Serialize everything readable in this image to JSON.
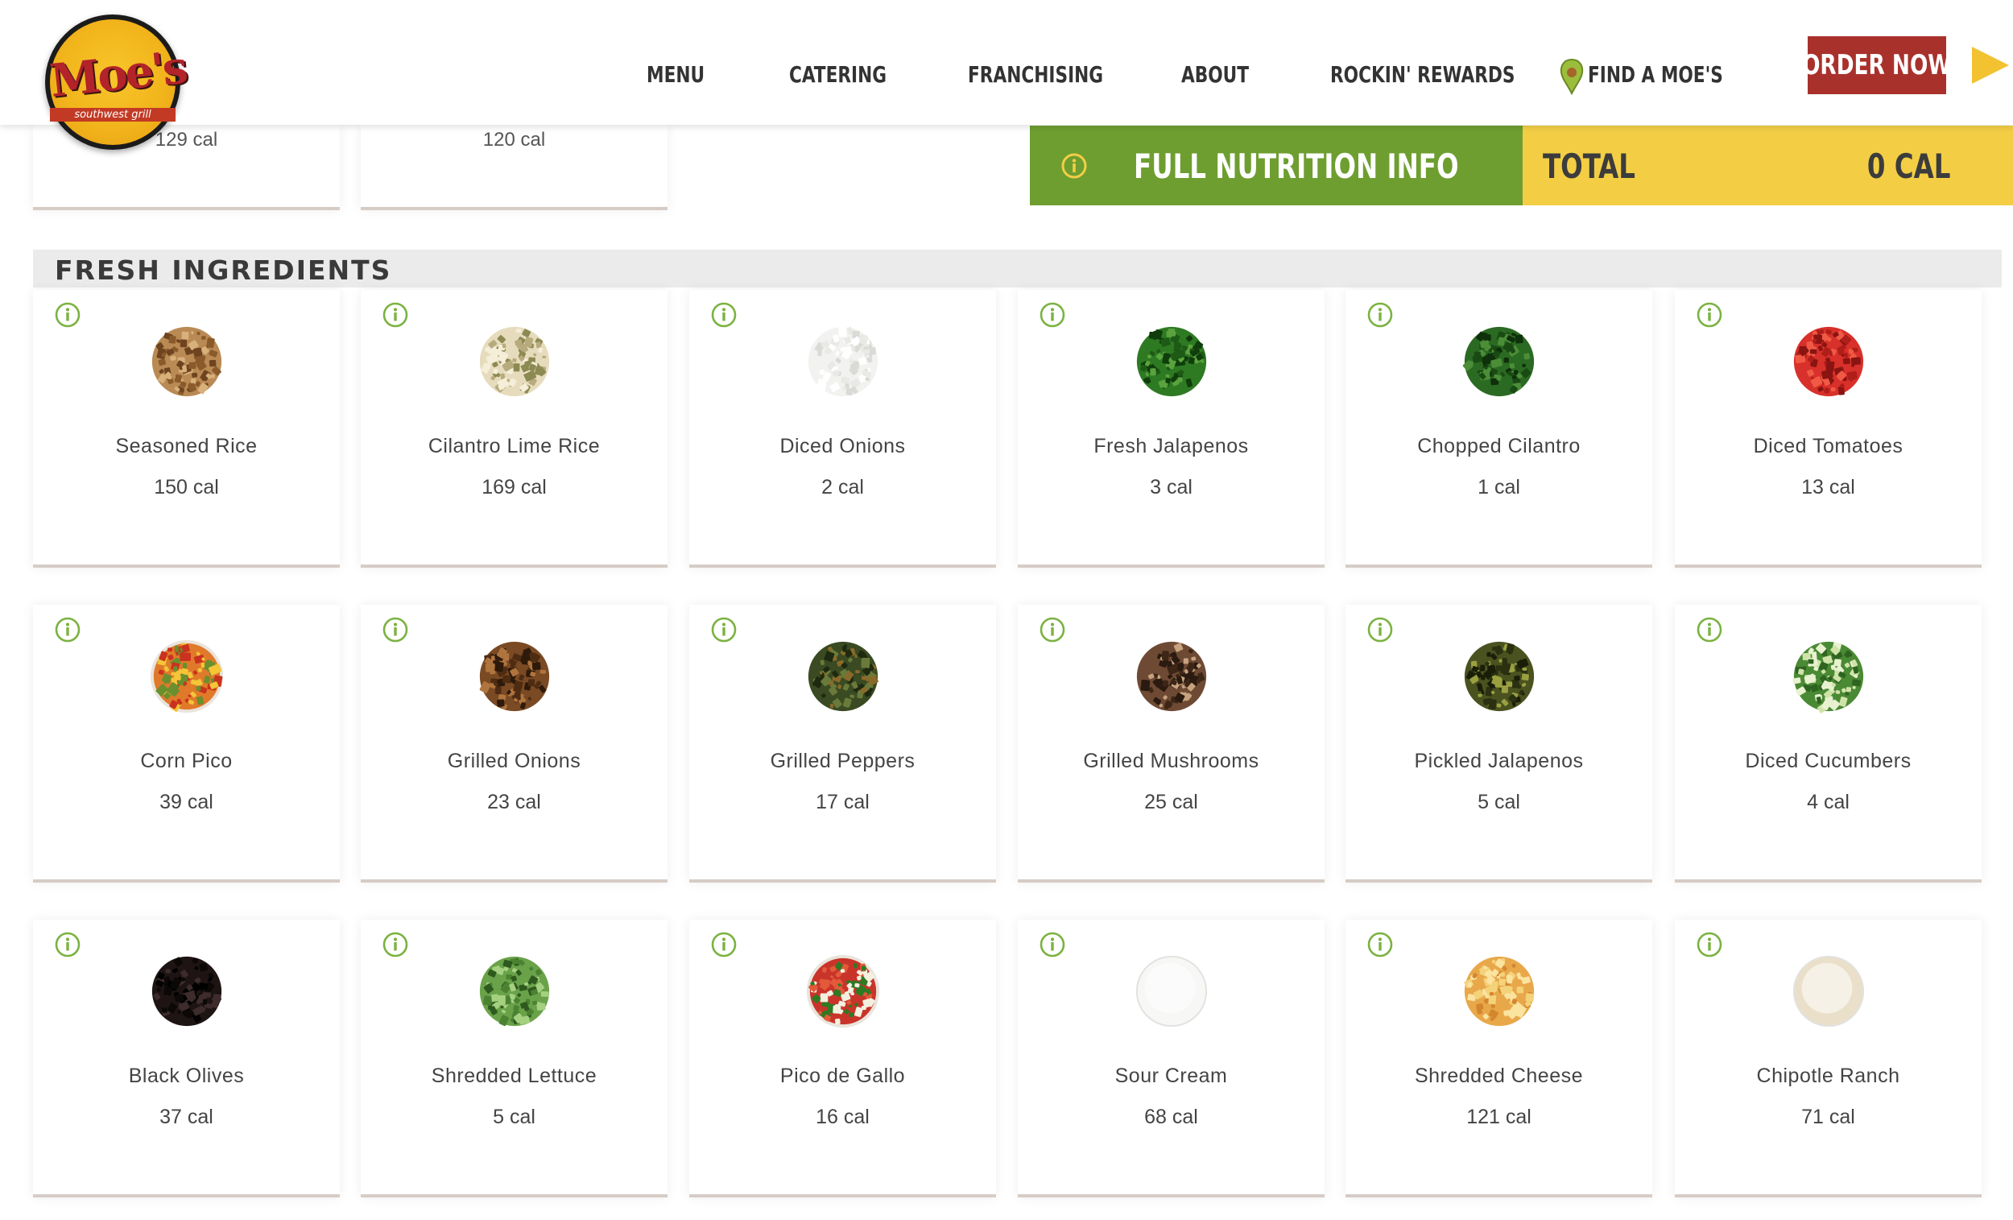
{
  "header": {
    "logo": {
      "word": "Moe's",
      "sub": "southwest grill"
    },
    "nav": [
      "MENU",
      "CATERING",
      "FRANCHISING",
      "ABOUT",
      "ROCKIN' REWARDS",
      "FIND A MOE'S"
    ],
    "order_button": "ORDER NOW"
  },
  "nutrition_bar": {
    "label": "FULL NUTRITION INFO",
    "total_label": "TOTAL",
    "total_value": "0 CAL"
  },
  "previous_items": [
    {
      "cal": "129 cal"
    },
    {
      "cal": "120 cal"
    }
  ],
  "section": {
    "title": "FRESH INGREDIENTS",
    "items": [
      {
        "name": "Seasoned Rice",
        "cal": "150 cal",
        "icon": "seasoned-rice-image"
      },
      {
        "name": "Cilantro Lime Rice",
        "cal": "169 cal",
        "icon": "cilantro-lime-rice-image"
      },
      {
        "name": "Diced Onions",
        "cal": "2 cal",
        "icon": "diced-onions-image"
      },
      {
        "name": "Fresh Jalapenos",
        "cal": "3 cal",
        "icon": "fresh-jalapenos-image"
      },
      {
        "name": "Chopped Cilantro",
        "cal": "1 cal",
        "icon": "chopped-cilantro-image"
      },
      {
        "name": "Diced Tomatoes",
        "cal": "13 cal",
        "icon": "diced-tomatoes-image"
      },
      {
        "name": "Corn Pico",
        "cal": "39 cal",
        "icon": "corn-pico-image"
      },
      {
        "name": "Grilled Onions",
        "cal": "23 cal",
        "icon": "grilled-onions-image"
      },
      {
        "name": "Grilled Peppers",
        "cal": "17 cal",
        "icon": "grilled-peppers-image"
      },
      {
        "name": "Grilled Mushrooms",
        "cal": "25 cal",
        "icon": "grilled-mushrooms-image"
      },
      {
        "name": "Pickled Jalapenos",
        "cal": "5 cal",
        "icon": "pickled-jalapenos-image"
      },
      {
        "name": "Diced Cucumbers",
        "cal": "4 cal",
        "icon": "diced-cucumbers-image"
      },
      {
        "name": "Black Olives",
        "cal": "37 cal",
        "icon": "black-olives-image"
      },
      {
        "name": "Shredded Lettuce",
        "cal": "5 cal",
        "icon": "shredded-lettuce-image"
      },
      {
        "name": "Pico de Gallo",
        "cal": "16 cal",
        "icon": "pico-de-gallo-image"
      },
      {
        "name": "Sour Cream",
        "cal": "68 cal",
        "icon": "sour-cream-image"
      },
      {
        "name": "Shredded Cheese",
        "cal": "121 cal",
        "icon": "shredded-cheese-image"
      },
      {
        "name": "Chipotle Ranch",
        "cal": "71 cal",
        "icon": "chipotle-ranch-image"
      }
    ]
  },
  "colors": {
    "nutrition_green": "#6e9e30",
    "total_yellow": "#f3ce45",
    "order_red": "#a9312c",
    "info_icon_green": "#7bb241"
  }
}
